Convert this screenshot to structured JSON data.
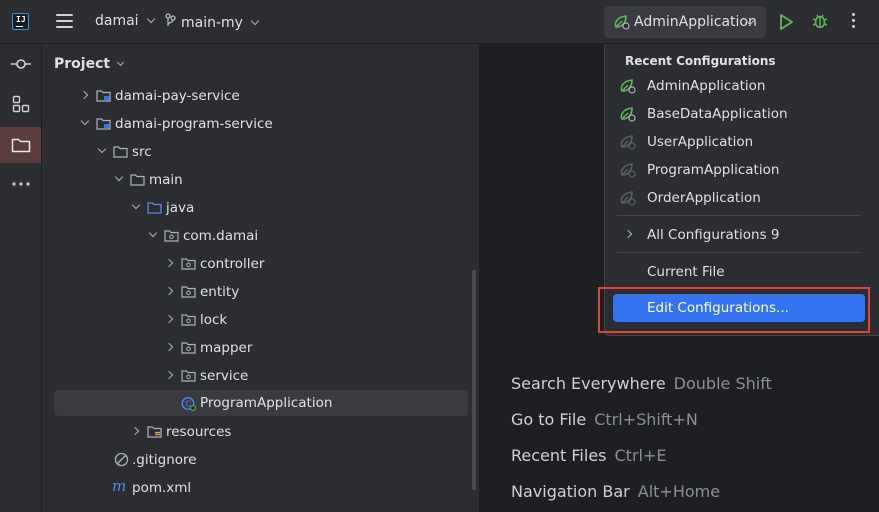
{
  "header": {
    "project": "damai",
    "branch": "main-my",
    "run_config": "AdminApplication"
  },
  "panel": {
    "title": "Project",
    "tree": [
      {
        "label": "damai-pay-service",
        "icon": "module-folder-icon",
        "expanded": false
      },
      {
        "label": "damai-program-service",
        "icon": "module-folder-icon",
        "expanded": true
      },
      {
        "label": "src",
        "icon": "folder-icon",
        "expanded": true
      },
      {
        "label": "main",
        "icon": "folder-icon",
        "expanded": true
      },
      {
        "label": "java",
        "icon": "source-folder-icon",
        "expanded": true
      },
      {
        "label": "com.damai",
        "icon": "package-icon",
        "expanded": true
      },
      {
        "label": "controller",
        "icon": "package-icon",
        "expanded": false
      },
      {
        "label": "entity",
        "icon": "package-icon",
        "expanded": false
      },
      {
        "label": "lock",
        "icon": "package-icon",
        "expanded": false
      },
      {
        "label": "mapper",
        "icon": "package-icon",
        "expanded": false
      },
      {
        "label": "service",
        "icon": "package-icon",
        "expanded": false
      },
      {
        "label": "ProgramApplication",
        "icon": "spring-class-icon",
        "selected": true
      },
      {
        "label": "resources",
        "icon": "resources-folder-icon",
        "expanded": false
      },
      {
        "label": ".gitignore",
        "icon": "gitignore-icon"
      },
      {
        "label": "pom.xml",
        "icon": "maven-icon"
      }
    ]
  },
  "popup": {
    "heading": "Recent Configurations",
    "recent": [
      {
        "label": "AdminApplication",
        "active": true
      },
      {
        "label": "BaseDataApplication",
        "active": true
      },
      {
        "label": "UserApplication",
        "active": false
      },
      {
        "label": "ProgramApplication",
        "active": false
      },
      {
        "label": "OrderApplication",
        "active": false
      }
    ],
    "all_configs": "All Configurations 9",
    "current_file": "Current File",
    "edit_configs": "Edit Configurations..."
  },
  "hints": [
    {
      "label": "Search Everywhere",
      "key": "Double Shift"
    },
    {
      "label": "Go to File",
      "key": "Ctrl+Shift+N"
    },
    {
      "label": "Recent Files",
      "key": "Ctrl+E"
    },
    {
      "label": "Navigation Bar",
      "key": "Alt+Home"
    }
  ],
  "colors": {
    "accent": "#3574f0",
    "spring_green": "#5fb85a",
    "highlight_border": "#e0453a"
  }
}
